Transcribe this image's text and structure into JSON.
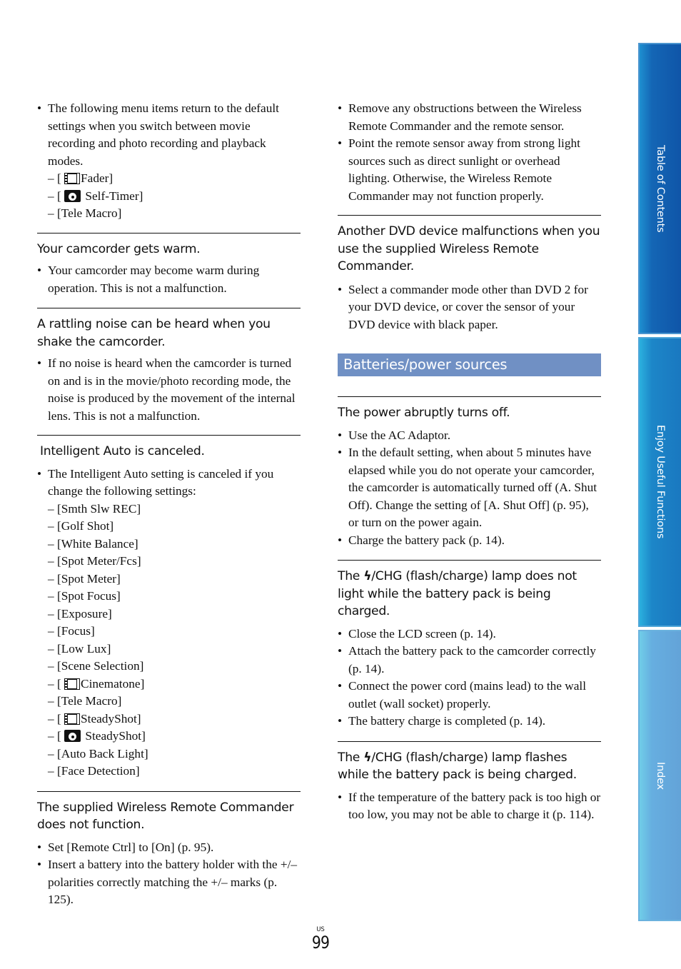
{
  "left_column": {
    "intro": {
      "bullet": "The following menu items return to the default settings when you switch between movie recording and photo recording and playback modes.",
      "subitems": [
        {
          "icon": "film-icon",
          "label": "Fader"
        },
        {
          "icon": "camera-icon",
          "label": "Self-Timer"
        },
        {
          "icon": "",
          "label": "Tele Macro"
        }
      ]
    },
    "sections": [
      {
        "heading": "Your camcorder gets warm.",
        "bullets": [
          "Your camcorder may become warm during operation. This is not a malfunction."
        ]
      },
      {
        "heading": "A rattling noise can be heard when you shake the camcorder.",
        "bullets": [
          "If no noise is heard when the camcorder is turned on and is in the movie/photo recording mode, the noise is produced by the movement of the internal lens. This is not a malfunction."
        ]
      },
      {
        "heading": "Intelligent Auto is canceled.",
        "bullets": [
          "The Intelligent Auto setting is canceled if you change the following settings:"
        ],
        "subitems": [
          {
            "icon": "",
            "label": "Smth Slw REC"
          },
          {
            "icon": "",
            "label": "Golf Shot"
          },
          {
            "icon": "",
            "label": "White Balance"
          },
          {
            "icon": "",
            "label": "Spot Meter/Fcs"
          },
          {
            "icon": "",
            "label": "Spot Meter"
          },
          {
            "icon": "",
            "label": "Spot Focus"
          },
          {
            "icon": "",
            "label": "Exposure"
          },
          {
            "icon": "",
            "label": "Focus"
          },
          {
            "icon": "",
            "label": "Low Lux"
          },
          {
            "icon": "",
            "label": "Scene Selection"
          },
          {
            "icon": "film-icon",
            "label": "Cinematone"
          },
          {
            "icon": "",
            "label": "Tele Macro"
          },
          {
            "icon": "film-icon",
            "label": "SteadyShot"
          },
          {
            "icon": "camera-icon",
            "label": "SteadyShot"
          },
          {
            "icon": "",
            "label": "Auto Back Light"
          },
          {
            "icon": "",
            "label": "Face Detection"
          }
        ]
      },
      {
        "heading": "The supplied Wireless Remote Commander does not function.",
        "bullets": [
          "Set [Remote Ctrl] to [On] (p. 95).",
          "Insert a battery into the battery holder with the +/– polarities correctly matching the +/– marks (p. 125)."
        ]
      }
    ]
  },
  "right_column": {
    "continued_bullets": [
      "Remove any obstructions between the Wireless Remote Commander and the remote sensor.",
      "Point the remote sensor away from strong light sources such as direct sunlight or overhead lighting. Otherwise, the Wireless Remote Commander may not function properly."
    ],
    "dvd_section": {
      "heading": "Another DVD device malfunctions when you use the supplied Wireless Remote Commander.",
      "bullets": [
        "Select a commander mode other than DVD 2 for your DVD device, or cover the sensor of your DVD device with black paper."
      ]
    },
    "section_bar": "Batteries/power sources",
    "battery_sections": [
      {
        "heading": "The power abruptly turns off.",
        "bullets": [
          "Use the AC Adaptor.",
          "In the default setting, when about 5 minutes have elapsed while you do not operate your camcorder, the camcorder is automatically turned off (A. Shut Off). Change the setting of [A. Shut Off] (p. 95), or turn on the power again.",
          "Charge the battery pack (p. 14)."
        ]
      },
      {
        "heading_pre": "The ",
        "heading_post": "/CHG (flash/charge) lamp does not light while the battery pack is being charged.",
        "bullets": [
          "Close the LCD screen (p. 14).",
          "Attach the battery pack to the camcorder correctly (p. 14).",
          "Connect the power cord (mains lead) to the wall outlet (wall socket) properly.",
          "The battery charge is completed (p. 14)."
        ]
      },
      {
        "heading_pre": "The ",
        "heading_post": "/CHG (flash/charge) lamp flashes while the battery pack is being charged.",
        "bullets": [
          "If the temperature of the battery pack is too high or too low, you may not be able to charge it (p. 114)."
        ]
      }
    ],
    "flash_glyph": "ϟ"
  },
  "side_tabs": [
    {
      "label": "Table of Contents"
    },
    {
      "label": "Enjoy Useful Functions"
    },
    {
      "label": "Index"
    }
  ],
  "footer": {
    "region": "US",
    "page_number": "99"
  },
  "colors": {
    "section_bar": "#7090c4",
    "tab_toc": "#0f55a8",
    "tab_enjoy": "#1a78c0",
    "tab_index": "#63a3d8"
  }
}
